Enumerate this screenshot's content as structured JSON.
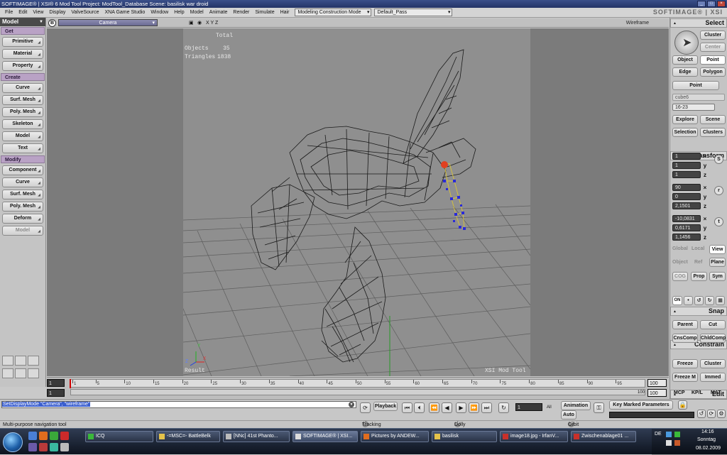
{
  "window": {
    "title": "SOFTIMAGE® | XSI® 6 Mod Tool Project: ModTool_Database    Scene: basilisk war droid",
    "brand": "SOFTIMAGE® | XSI"
  },
  "menubar": {
    "items": [
      "File",
      "Edit",
      "View",
      "Display",
      "ValveSource",
      "XNA Game Studio",
      "Window",
      "Help",
      "Model",
      "Animate",
      "Render",
      "Simulate",
      "Hair"
    ],
    "mode_select": "Modeling Construction Mode",
    "pass_select": "Default_Pass"
  },
  "left_panel": {
    "header": "Model",
    "sections": {
      "get": "Get",
      "create": "Create",
      "modify": "Modify"
    },
    "get_buttons": [
      "Primitive",
      "Material",
      "Property"
    ],
    "create_buttons": [
      "Curve",
      "Surf. Mesh",
      "Poly. Mesh",
      "Skeleton",
      "Model",
      "Text"
    ],
    "modify_buttons": [
      "Component",
      "Curve",
      "Surf. Mesh",
      "Poly. Mesh",
      "Deform",
      "Model"
    ]
  },
  "viewport": {
    "header_letter": "B",
    "camera": "Camera",
    "axes_label": "X Y Z",
    "display_mode": "Wireframe",
    "stats_title": "Total",
    "stats": [
      {
        "label": "Objects",
        "value": "35"
      },
      {
        "label": "Triangles",
        "value": "1838"
      }
    ],
    "bottom_left": "Result",
    "bottom_right": "XSI Mod Tool",
    "axis_x": "X",
    "axis_y": "Y",
    "axis_z": "Z"
  },
  "right_panel": {
    "select_title": "Select",
    "cluster": "Cluster",
    "center": "Center",
    "modes": [
      "Object",
      "Point",
      "Edge",
      "Polygon"
    ],
    "filter": "Point",
    "object_name": "cube6",
    "range": "16-23",
    "explore": "Explore",
    "scene": "Scene",
    "selection": "Selection",
    "clusters": "Clusters",
    "transform_title": "Transform",
    "scale": [
      "1",
      "1",
      "1"
    ],
    "rotate": [
      "90",
      "0",
      "2,1501"
    ],
    "translate": [
      "-10,0831",
      "0,6171",
      "1,1456"
    ],
    "axis_labels": [
      "x",
      "y",
      "z"
    ],
    "s_label": "S",
    "r_label": "r",
    "t_label": "t",
    "ref_row1": [
      "Global",
      "Local",
      "View"
    ],
    "ref_row2": [
      "Object",
      "Ref",
      "Plane"
    ],
    "ref_row3": [
      "COG",
      "Prop",
      "Sym"
    ],
    "snap_title": "Snap",
    "snap_on": "ON",
    "constrain_title": "Constrain",
    "constrain_buttons": [
      "Parent",
      "Cut",
      "CnsComp",
      "ChldComp"
    ],
    "edit_title": "Edit",
    "edit_buttons": [
      "Freeze",
      "Cluster",
      "Freeze M",
      "Immed"
    ],
    "bottom_tabs": [
      "MCP",
      "KP/L",
      "MAT"
    ]
  },
  "timeline": {
    "start": "1",
    "end_in": "1",
    "end_field": "100",
    "end_field2": "100",
    "end_small": "100",
    "ticks": [
      "1",
      "5",
      "10",
      "15",
      "20",
      "25",
      "30",
      "35",
      "40",
      "45",
      "50",
      "55",
      "60",
      "65",
      "70",
      "75",
      "80",
      "85",
      "90",
      "95"
    ]
  },
  "command_bar": {
    "command": "SetDisplayMode \"Camera\", \"wireframe\"",
    "playback": "Playback",
    "frame": "1",
    "all": "All",
    "animation": "Animation",
    "auto": "Auto",
    "key_marked": "Key Marked Parameters"
  },
  "status": {
    "message": "Multi-purpose navigation tool",
    "mouse_l": "L",
    "tracking": "Tracking",
    "mouse_m": "M",
    "dolly": "Dolly",
    "mouse_r": "R",
    "orbit": "Orbit"
  },
  "taskbar": {
    "tasks": [
      "ICQ",
      "-=MSC=- BattleBelk",
      "[NNc] 41st Phanto...",
      "SOFTIMAGE® | XSI...",
      "Pictures by ANDEW...",
      "basilisk",
      "image18.jpg - IrfanV...",
      "Zwischenablage01 ..."
    ],
    "lang": "DE",
    "time": "14:16",
    "day": "Sonntag",
    "date": "08.02.2009"
  }
}
